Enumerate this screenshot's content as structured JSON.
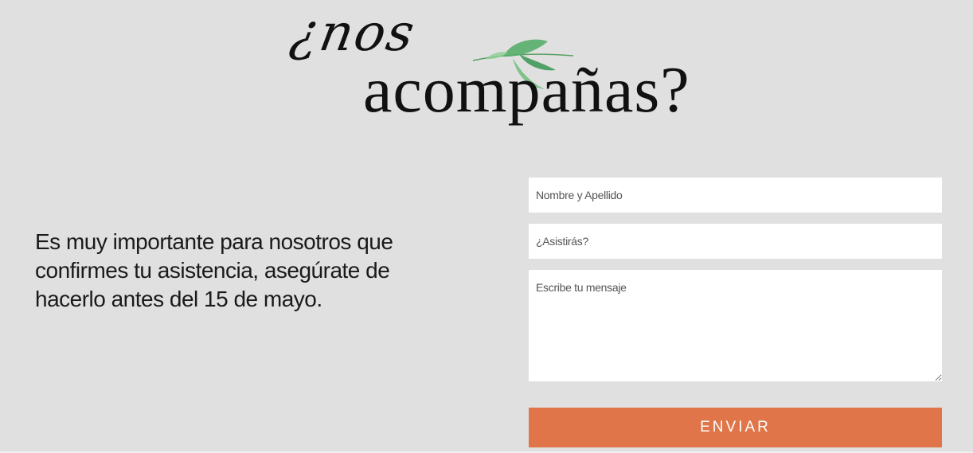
{
  "header": {
    "script_text": "¿nos",
    "title_text": "acompañas?"
  },
  "intro": {
    "text": "Es muy importante para nosotros que confirmes tu asistencia, asegúrate de hacerlo antes del 15 de mayo."
  },
  "form": {
    "name_placeholder": "Nombre y Apellido",
    "attend_placeholder": "¿Asistirás?",
    "message_placeholder": "Escribe tu mensaje",
    "submit_label": "ENVIAR"
  },
  "colors": {
    "background": "#e0e0e0",
    "accent": "#df7548",
    "leaf": "#4caf6a"
  },
  "icons": {
    "decoration": "leaves-icon"
  }
}
